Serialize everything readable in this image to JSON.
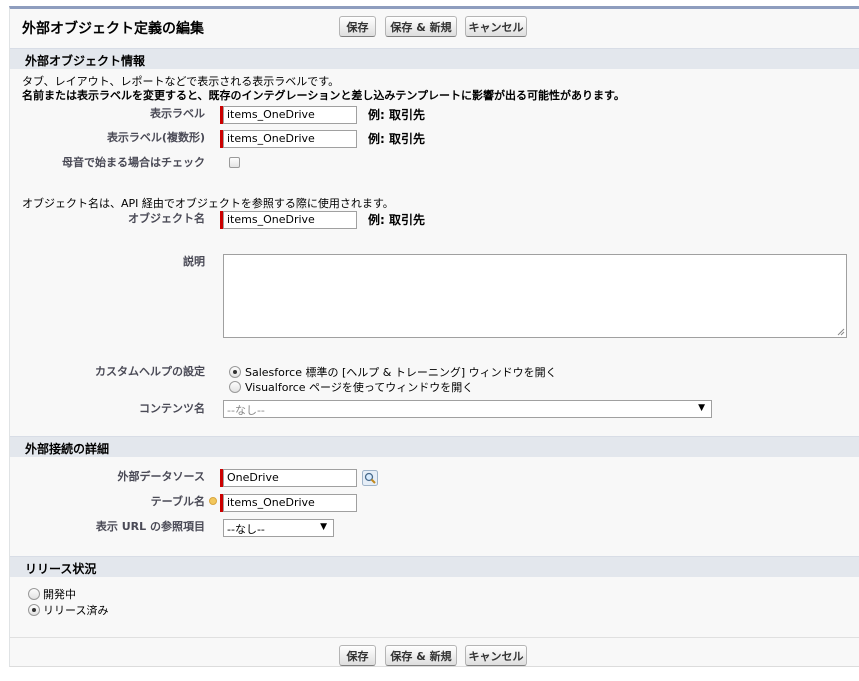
{
  "page_title": "外部オブジェクト定義の編集",
  "buttons": {
    "save": "保存",
    "save_new": "保存 & 新規",
    "cancel": "キャンセル"
  },
  "sections": {
    "object_info": {
      "title": "外部オブジェクト情報",
      "intro_line1": "タブ、レイアウト、レポートなどで表示される表示ラベルです。",
      "intro_line2": "名前または表示ラベルを変更すると、既存のインテグレーションと差し込みテンプレートに影響が出る可能性があります。",
      "label_field": {
        "label": "表示ラベル",
        "value": "items_OneDrive",
        "example": "例: 取引先"
      },
      "plural_label_field": {
        "label": "表示ラベル(複数形)",
        "value": "items_OneDrive",
        "example": "例: 取引先"
      },
      "vowel_field": {
        "label": "母音で始まる場合はチェック",
        "checked": false
      },
      "api_note": "オブジェクト名は、API 経由でオブジェクトを参照する際に使用されます。",
      "object_name_field": {
        "label": "オブジェクト名",
        "value": "items_OneDrive",
        "example": "例: 取引先"
      },
      "description_field": {
        "label": "説明",
        "value": ""
      },
      "custom_help": {
        "label": "カスタムヘルプの設定",
        "option1": "Salesforce 標準の [ヘルプ & トレーニング] ウィンドウを開く",
        "option2": "Visualforce ページを使ってウィンドウを開く",
        "selected": "option1"
      },
      "content_name": {
        "label": "コンテンツ名",
        "value": "--なし--"
      }
    },
    "connection": {
      "title": "外部接続の詳細",
      "data_source": {
        "label": "外部データソース",
        "value": "OneDrive",
        "icon": "lookup-icon"
      },
      "table_name": {
        "label": "テーブル名",
        "value": "items_OneDrive"
      },
      "url_ref": {
        "label": "表示 URL の参照項目",
        "value": "--なし--"
      }
    },
    "release": {
      "title": "リリース状況",
      "option_dev": "開発中",
      "option_released": "リリース済み",
      "selected": "released"
    }
  },
  "colors": {
    "required": "#cc0000",
    "section_bar": "#e3e7ed",
    "frame_top": "#8e9dbe"
  }
}
